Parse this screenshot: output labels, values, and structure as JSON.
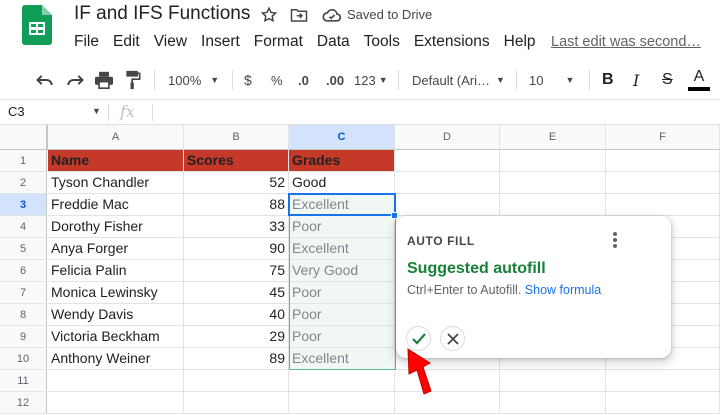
{
  "app": {
    "title": "IF and IFS Functions",
    "saved_status": "Saved to Drive",
    "last_edit": "Last edit was second…",
    "menu": [
      "File",
      "Edit",
      "View",
      "Insert",
      "Format",
      "Data",
      "Tools",
      "Extensions",
      "Help"
    ]
  },
  "toolbar": {
    "zoom": "100%",
    "currency": "$",
    "percent": "%",
    "decrease_decimal": ".0",
    "increase_decimal": ".00",
    "more_formats": "123",
    "font": "Default (Ari…",
    "font_size": "10",
    "bold": "B",
    "italic": "I",
    "strike": "S",
    "text_color_letter": "A"
  },
  "formula_bar": {
    "name_box": "C3",
    "fx": "fx"
  },
  "columns": [
    "A",
    "B",
    "C",
    "D",
    "E",
    "F"
  ],
  "rows": [
    "1",
    "2",
    "3",
    "4",
    "5",
    "6",
    "7",
    "8",
    "9",
    "10",
    "11",
    "12"
  ],
  "sheet": {
    "header": {
      "name": "Name",
      "scores": "Scores",
      "grades": "Grades"
    },
    "records": [
      {
        "name": "Tyson Chandler",
        "score": "52",
        "grade": " Good"
      },
      {
        "name": "Freddie Mac",
        "score": "88",
        "grade": "Excellent"
      },
      {
        "name": "Dorothy Fisher",
        "score": "33",
        "grade": "Poor"
      },
      {
        "name": "Anya Forger",
        "score": "90",
        "grade": "Excellent"
      },
      {
        "name": "Felicia Palin",
        "score": "75",
        "grade": "Very Good"
      },
      {
        "name": "Monica Lewinsky",
        "score": "45",
        "grade": "Poor"
      },
      {
        "name": "Wendy Davis",
        "score": "40",
        "grade": "Poor"
      },
      {
        "name": "Victoria Beckham",
        "score": "29",
        "grade": "Poor"
      },
      {
        "name": "Anthony Weiner",
        "score": "89",
        "grade": "Excellent"
      }
    ]
  },
  "autofill": {
    "label": "AUTO FILL",
    "title": "Suggested autofill",
    "description": "Ctrl+Enter to Autofill.",
    "link": "Show formula"
  },
  "colors": {
    "header_fill": "#c53929",
    "suggestion_text": "#188038",
    "selection": "#1a73e8",
    "arrow": "#ff0000"
  }
}
